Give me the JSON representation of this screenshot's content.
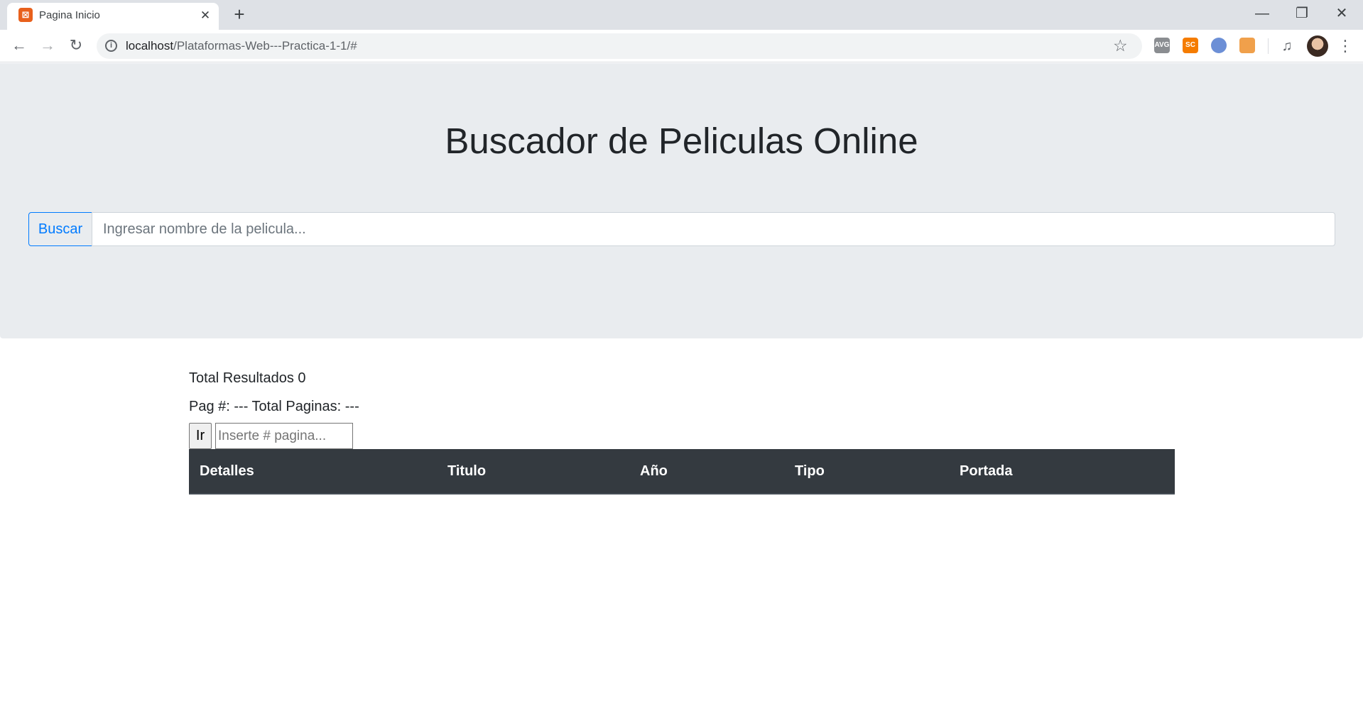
{
  "browser": {
    "tab": {
      "title": "Pagina Inicio",
      "favicon": "xampp-icon",
      "close": "✕"
    },
    "new_tab": "+",
    "window": {
      "minimize": "—",
      "maximize": "❐",
      "close": "✕"
    },
    "nav": {
      "back": "←",
      "forward": "→",
      "reload": "↻"
    },
    "address": {
      "host": "localhost",
      "path": "/Plataformas-Web---Practica-1-1/#"
    },
    "icons": {
      "info": "i",
      "star": "☆",
      "media": "♫",
      "menu": "⋮"
    },
    "extensions": [
      {
        "name": "avg-extension-icon",
        "label": "AVG"
      },
      {
        "name": "sc-extension-icon",
        "label": "SC"
      },
      {
        "name": "dashlane-extension-icon",
        "label": ""
      },
      {
        "name": "metamask-extension-icon",
        "label": ""
      }
    ]
  },
  "page": {
    "title": "Buscador de Peliculas Online",
    "search": {
      "button_label": "Buscar",
      "placeholder": "Ingresar nombre de la pelicula..."
    },
    "results": {
      "total_line": "Total Resultados 0",
      "page_line": "Pag #: --- Total Paginas: ---",
      "go_button_label": "Ir",
      "page_input_placeholder": "Inserte # pagina...",
      "table_headers": [
        "Detalles",
        "Titulo",
        "Año",
        "Tipo",
        "Portada"
      ]
    }
  },
  "colors": {
    "jumbotron": "#e9ecef",
    "primary": "#007bff",
    "table_header": "#343a40"
  }
}
